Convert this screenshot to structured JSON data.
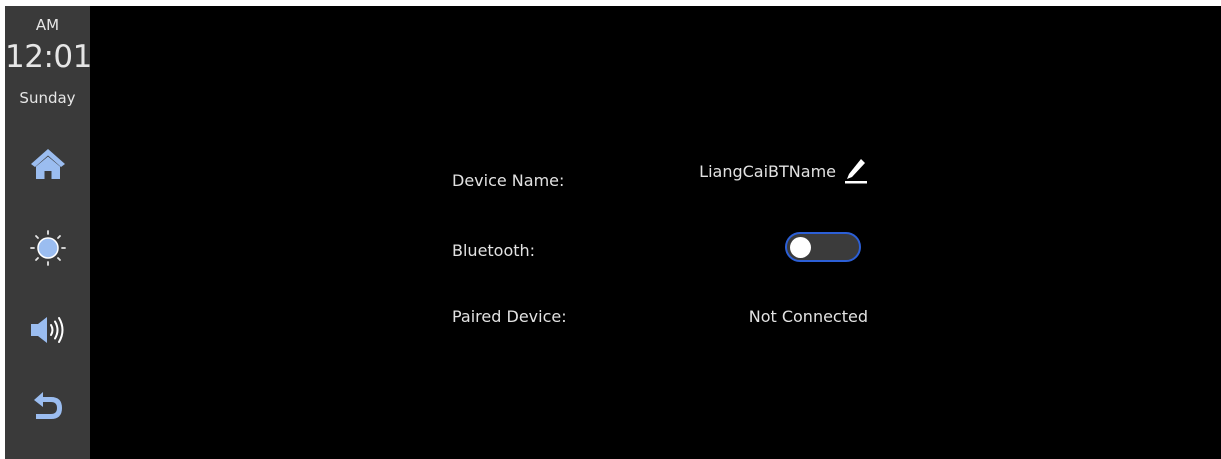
{
  "status": {
    "ampm": "AM",
    "time": "12:01",
    "day": "Sunday"
  },
  "nav": {
    "icons": [
      "home-icon",
      "brightness-icon",
      "volume-icon",
      "back-icon"
    ],
    "accent_color": "#9bbdf0"
  },
  "settings": {
    "device_name_label": "Device Name:",
    "device_name_value": "LiangCaiBTName",
    "bluetooth_label": "Bluetooth:",
    "bluetooth_enabled": false,
    "paired_device_label": "Paired Device:",
    "paired_device_value": "Not Connected"
  },
  "colors": {
    "background": "#000000",
    "sidebar": "#3a3a3a",
    "toggle_border": "#2c5fd6"
  }
}
